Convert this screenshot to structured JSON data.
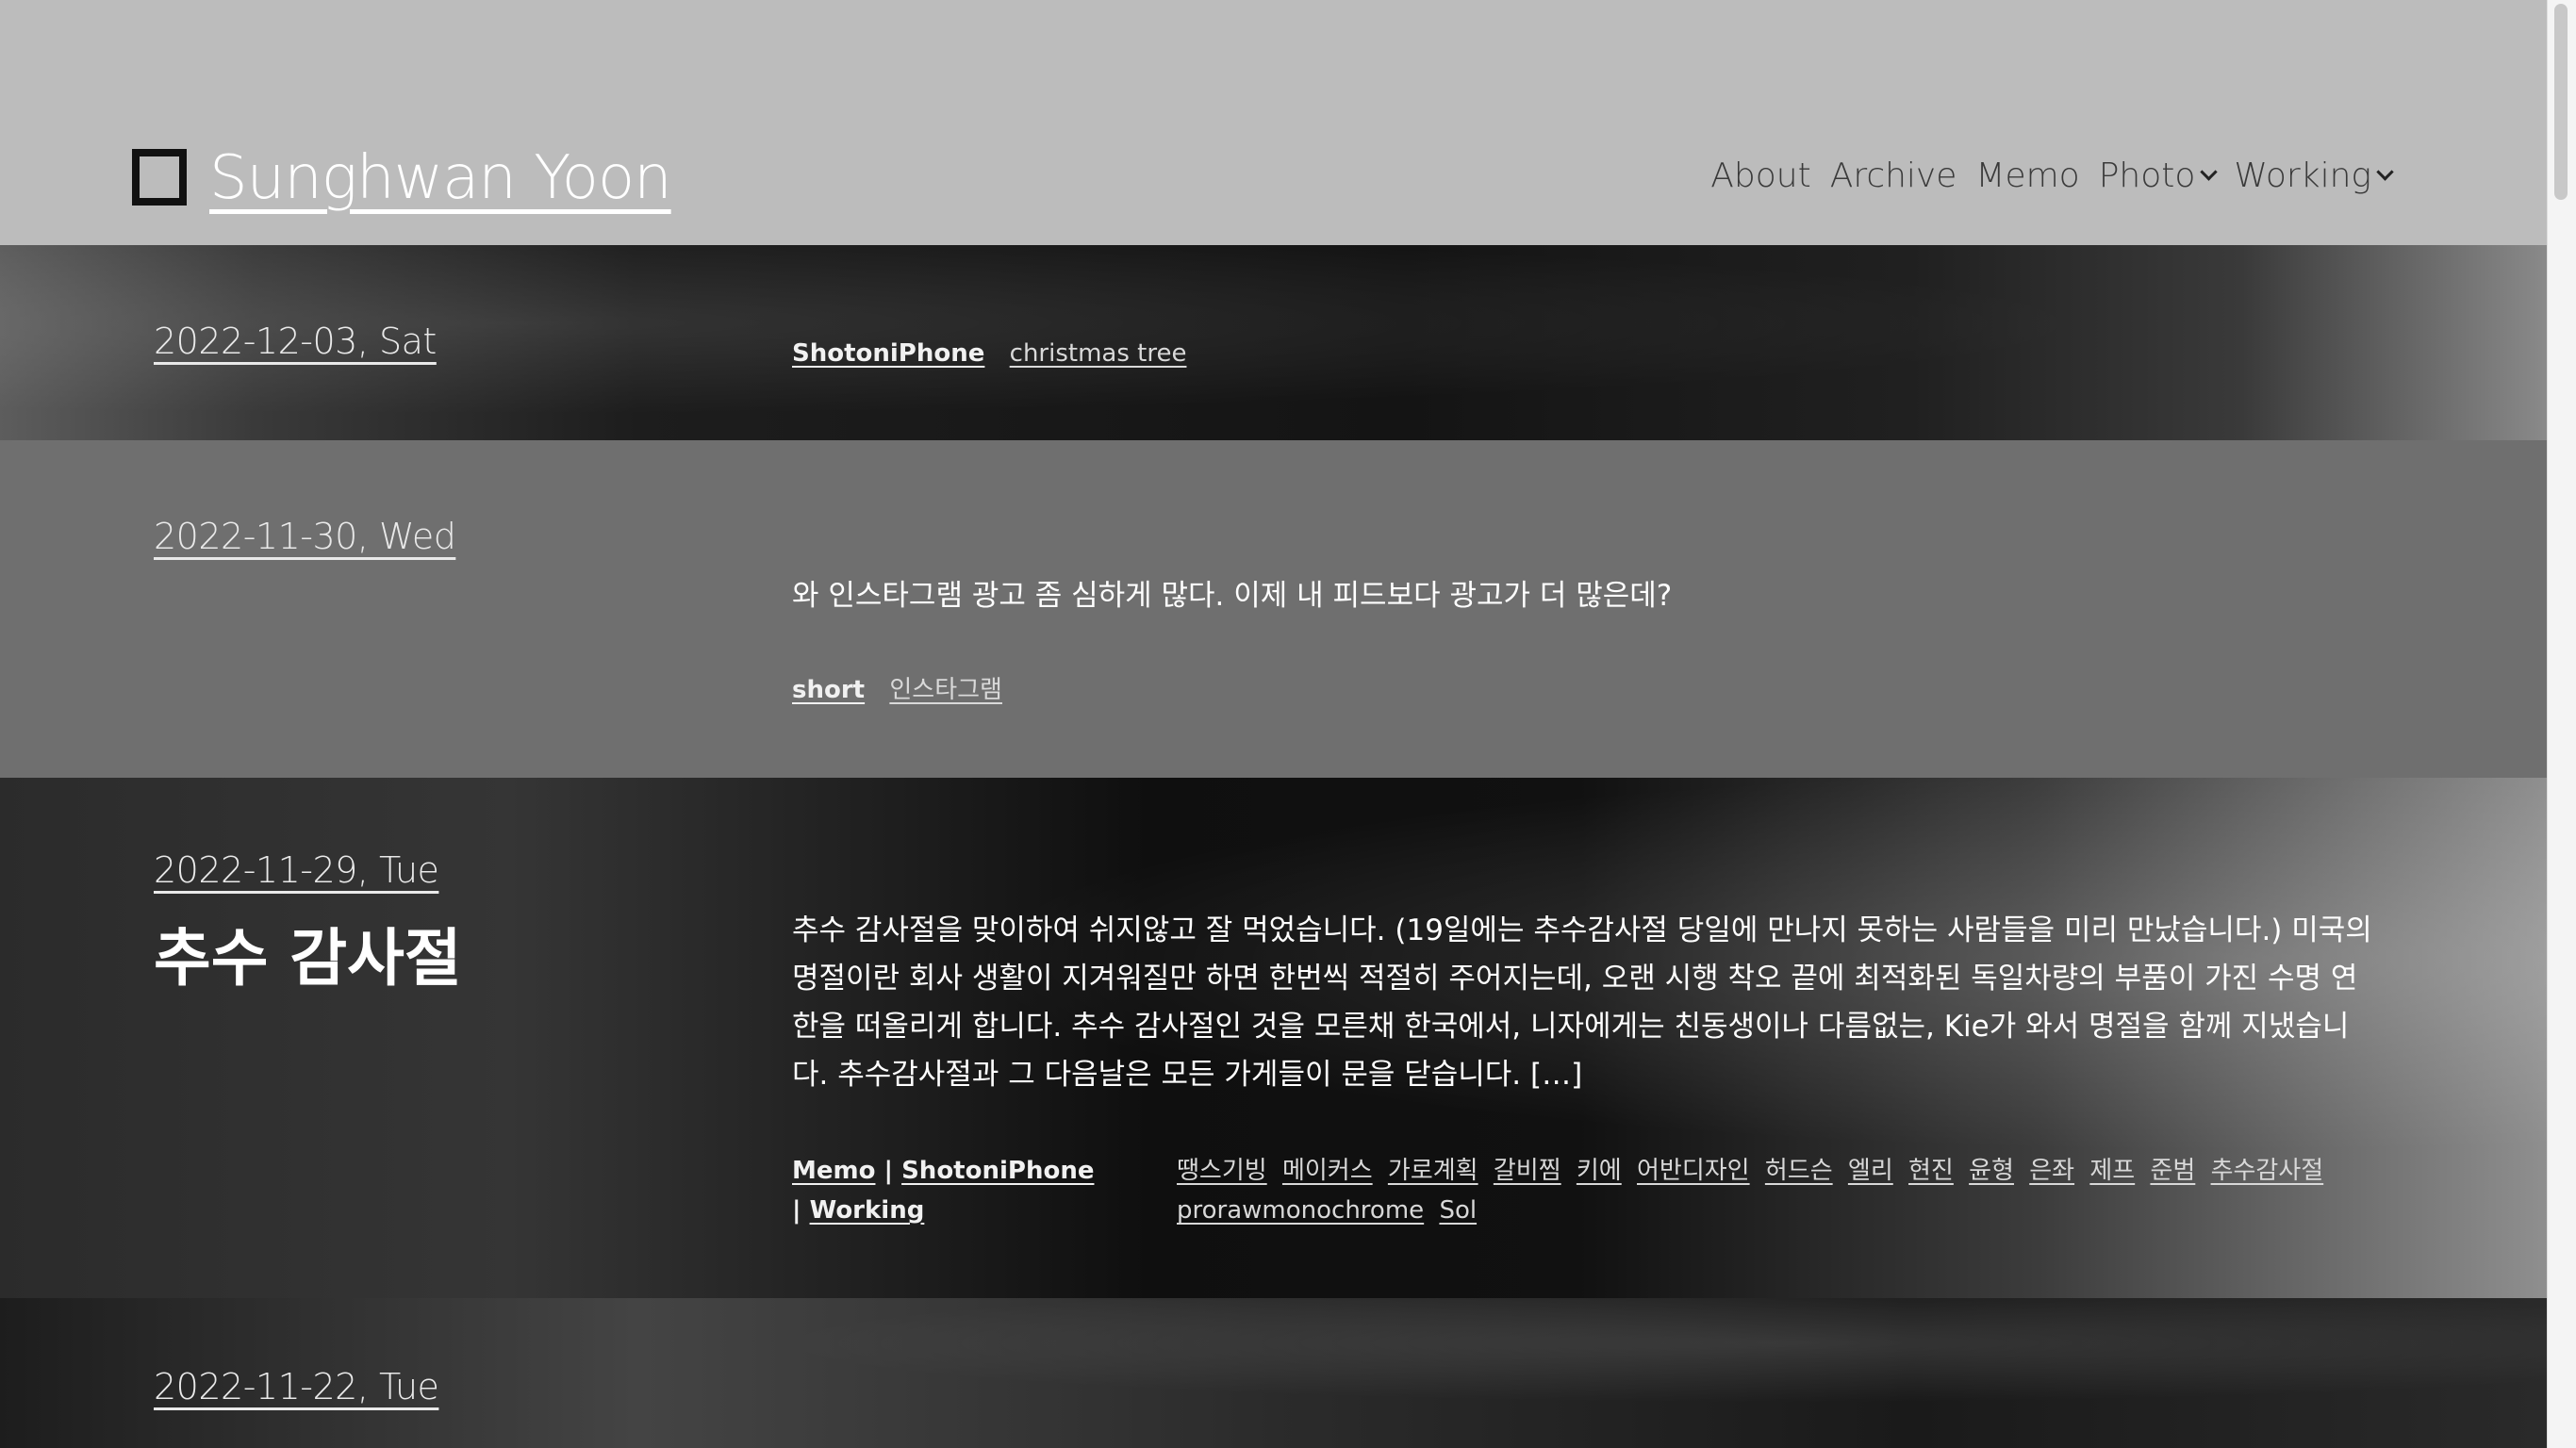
{
  "site": {
    "title": "Sunghwan Yoon",
    "nav": [
      {
        "label": "About"
      },
      {
        "label": "Archive"
      },
      {
        "label": "Memo"
      },
      {
        "label": "Photo"
      },
      {
        "label": "Working"
      }
    ]
  },
  "posts": [
    {
      "date": "2022-12-03, Sat",
      "tags": [
        "ShotoniPhone",
        "christmas tree"
      ]
    },
    {
      "date": "2022-11-30, Wed",
      "excerpt": "와 인스타그램 광고 좀 심하게 많다. 이제 내 피드보다 광고가 더 많은데?",
      "tags": [
        "short",
        "인스타그램"
      ]
    },
    {
      "date": "2022-11-29, Tue",
      "title": "추수 감사절",
      "excerpt": "추수 감사절을 맞이하여 쉬지않고 잘 먹었습니다. (19일에는 추수감사절 당일에 만나지 못하는 사람들을 미리 만났습니다.) 미국의 명절이란 회사 생활이 지겨워질만 하면 한번씩 적절히 주어지는데, 오랜 시행 착오 끝에 최적화된 독일차량의 부품이 가진 수명 연한을 떠올리게 합니다. 추수 감사절인 것을 모른채 한국에서, 니자에게는 친동생이나 다름없는, Kie가 와서 명절을 함께 지냈습니다. 추수감사절과 그 다음날은 모든 가게들이 문을 닫습니다. […]",
      "categories": [
        "Memo",
        "ShotoniPhone",
        "Working"
      ],
      "tags": [
        "땡스기빙",
        "메이커스",
        "가로계획",
        "갈비찜",
        "키에",
        "어반디자인",
        "허드슨",
        "엘리",
        "현진",
        "윤형",
        "은좌",
        "제프",
        "준범",
        "추수감사절",
        "prorawmonochrome",
        "Sol"
      ]
    },
    {
      "date": "2022-11-22, Tue",
      "title": "",
      "excerpt": ""
    }
  ]
}
